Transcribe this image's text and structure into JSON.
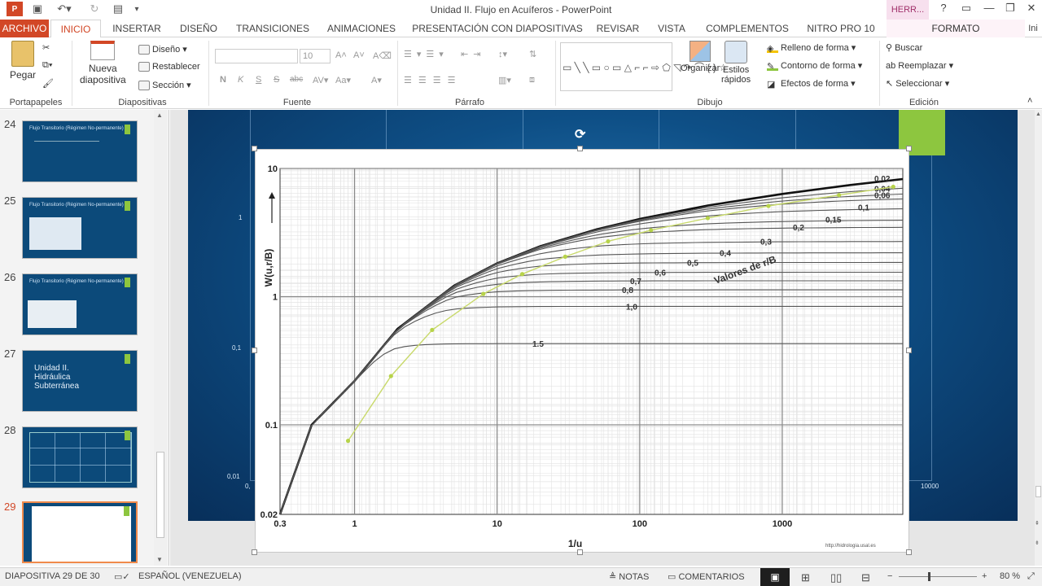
{
  "window": {
    "title": "Unidad II. Flujo en Acuíferos - PowerPoint",
    "context_tab_header": "HERR...",
    "colors": {
      "accent": "#d24726",
      "slide_bg": "#0b4578",
      "slide_accent": "#8dc63f"
    }
  },
  "tabs": [
    "ARCHIVO",
    "INICIO",
    "INSERTAR",
    "DISEÑO",
    "TRANSICIONES",
    "ANIMACIONES",
    "PRESENTACIÓN CON DIAPOSITIVAS",
    "REVISAR",
    "VISTA",
    "COMPLEMENTOS",
    "NITRO PRO 10",
    "FORMATO"
  ],
  "user_truncated": "Ini",
  "ribbon": {
    "portapapeles": {
      "pegar": "Pegar",
      "label": "Portapapeles"
    },
    "diapositivas": {
      "nueva": "Nueva",
      "diapositiva": "diapositiva",
      "diseno": "Diseño",
      "restablecer": "Restablecer",
      "seccion": "Sección",
      "label": "Diapositivas"
    },
    "fuente": {
      "size": "10",
      "label": "Fuente",
      "n": "N",
      "k": "K",
      "s": "S",
      "abc": "abc"
    },
    "parrafo": {
      "label": "Párrafo"
    },
    "dibujo": {
      "organizar": "Organizar",
      "estilos": "Estilos",
      "rapidos": "rápidos",
      "relleno": "Relleno de forma",
      "contorno": "Contorno de forma",
      "efectos": "Efectos de forma",
      "label": "Dibujo"
    },
    "edicion": {
      "buscar": "Buscar",
      "reemplazar": "Reemplazar",
      "seleccionar": "Seleccionar",
      "label": "Edición"
    }
  },
  "slides": [
    {
      "num": "24",
      "title": "Flujo Transitorio (Régimen No-permanente)"
    },
    {
      "num": "25",
      "title": "Flujo Transitorio (Régimen No-permanente)"
    },
    {
      "num": "26",
      "title": "Flujo Transitorio (Régimen No-permanente)"
    },
    {
      "num": "27",
      "title": "Unidad II. Hidráulica Subterránea"
    },
    {
      "num": "28",
      "title": ""
    },
    {
      "num": "29",
      "title": ""
    }
  ],
  "slide_labels": {
    "l1": "1",
    "l01": "0,1",
    "l001": "0,01",
    "l10000": "10000",
    "l0": "0,"
  },
  "chart_data": {
    "type": "line",
    "title": "",
    "xlabel": "1/u",
    "ylabel": "W(u,r/B)",
    "scale": "log-log",
    "xlim": [
      0.3,
      7000
    ],
    "ylim": [
      0.02,
      10
    ],
    "x_ticks": [
      "0.3",
      "1",
      "10",
      "100",
      "1000"
    ],
    "y_ticks": [
      "0.02",
      "0.1",
      "1",
      "10"
    ],
    "legend_title": "Valores de r/B",
    "curve_labels": [
      "0,02",
      "0,04",
      "0,06",
      "0,1",
      "0,15",
      "0,2",
      "0,3",
      "0,4",
      "0,5",
      "0,6",
      "0,7",
      "0,8",
      "1,0",
      "1.5"
    ],
    "source_note": "http://hidrologia.usal.es",
    "theis_curve": {
      "x": [
        0.3,
        0.5,
        1,
        2,
        5,
        10,
        20,
        50,
        100,
        300,
        1000,
        3000,
        7000
      ],
      "y": [
        0.02,
        0.1,
        0.22,
        0.56,
        1.22,
        1.82,
        2.47,
        3.35,
        4.04,
        5.14,
        6.33,
        7.43,
        8.27
      ]
    },
    "leaky_limits": [
      {
        "rB": "0,02",
        "W": 8.4
      },
      {
        "rB": "0,04",
        "W": 7.0
      },
      {
        "rB": "0,06",
        "W": 6.2
      },
      {
        "rB": "0,1",
        "W": 5.0
      },
      {
        "rB": "0,15",
        "W": 4.0
      },
      {
        "rB": "0,2",
        "W": 3.5
      },
      {
        "rB": "0,3",
        "W": 2.7
      },
      {
        "rB": "0,4",
        "W": 2.2
      },
      {
        "rB": "0,5",
        "W": 1.85
      },
      {
        "rB": "0,6",
        "W": 1.55
      },
      {
        "rB": "0,7",
        "W": 1.33
      },
      {
        "rB": "0,8",
        "W": 1.13
      },
      {
        "rB": "1,0",
        "W": 0.84
      },
      {
        "rB": "1.5",
        "W": 0.43
      }
    ],
    "marked_points": {
      "x": [
        0.9,
        1.8,
        3.5,
        8,
        15,
        30,
        60,
        120,
        300,
        800,
        2500,
        6000
      ],
      "y": [
        0.075,
        0.24,
        0.55,
        1.05,
        1.5,
        2.05,
        2.7,
        3.3,
        4.1,
        5.1,
        6.2,
        7.2
      ]
    }
  },
  "status": {
    "slide": "DIAPOSITIVA 29 DE 30",
    "language": "ESPAÑOL (VENEZUELA)",
    "notas": "NOTAS",
    "comentarios": "COMENTARIOS",
    "zoom": "80 %"
  }
}
